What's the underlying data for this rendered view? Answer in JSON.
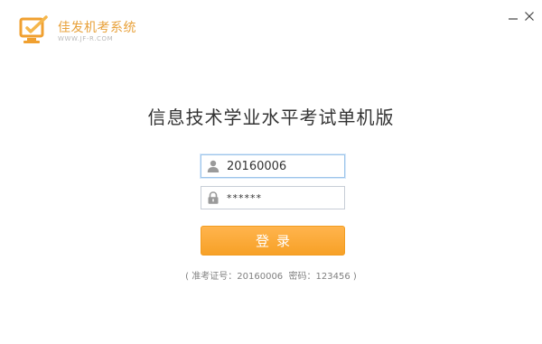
{
  "app": {
    "name": "佳发机考系统",
    "url": "WWW.JF-R.COM"
  },
  "window_controls": {
    "minimize": "minimize",
    "close": "close"
  },
  "main": {
    "title": "信息技术学业水平考试单机版"
  },
  "login_form": {
    "username_value": "20160006",
    "password_value": "******",
    "login_label": "登录"
  },
  "hint": {
    "open": "(",
    "candidate_label": "准考证号：",
    "candidate_value": "20160006",
    "password_label": "密码：",
    "password_value": "123456",
    "close": ")"
  },
  "colors": {
    "brand": "#e8a13a",
    "button": "#f7a127",
    "active_border": "#9ec5ea"
  },
  "icons": {
    "logo": "app-logo-icon",
    "user": "user-icon",
    "lock": "lock-icon",
    "minimize": "minimize-icon",
    "close": "close-icon"
  }
}
